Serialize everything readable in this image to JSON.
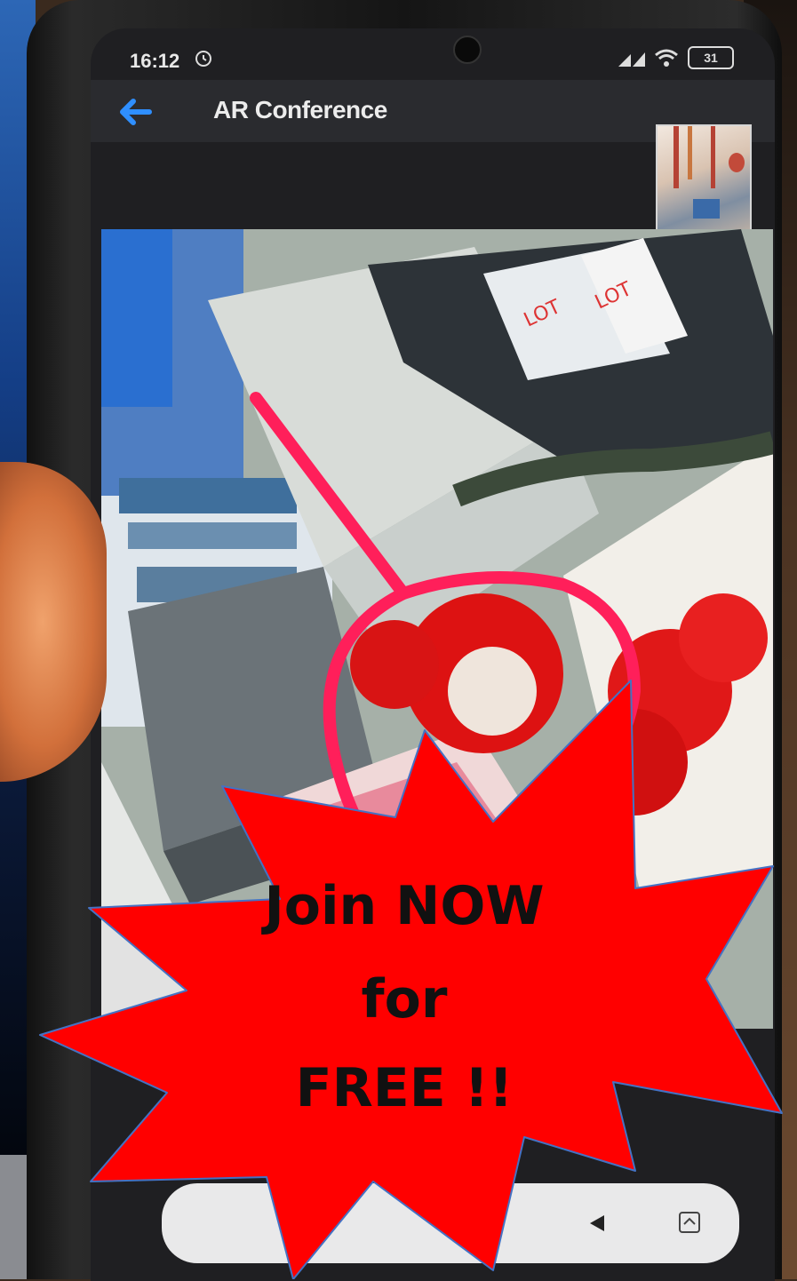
{
  "status_bar": {
    "time": "16:12",
    "alarm_icon": "alarm-icon",
    "battery": "31"
  },
  "app_bar": {
    "back_icon": "back-arrow-icon",
    "title": "AR Conference"
  },
  "promo": {
    "line1": "Join NOW",
    "line2": "for",
    "line3": "FREE !!"
  },
  "colors": {
    "burst_fill": "#ff0000",
    "burst_stroke": "#4472c4",
    "annotation": "#ff1f5a",
    "back_arrow": "#2f8fff"
  },
  "nav_bar": {
    "recents_icon": "square-icon",
    "home_icon": "circle-icon",
    "back_icon": "triangle-back-icon",
    "rotate_icon": "rotate-screen-icon"
  }
}
